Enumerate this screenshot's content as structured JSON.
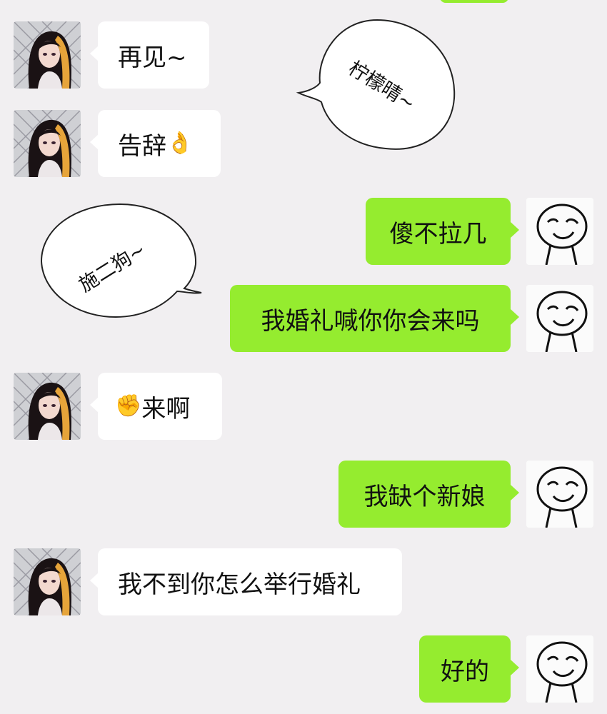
{
  "messages": [
    {
      "side": "left",
      "text": "再见~"
    },
    {
      "side": "left",
      "text": "告辞",
      "emoji": "👌"
    },
    {
      "side": "right",
      "text": "傻不拉几"
    },
    {
      "side": "right",
      "text": "我婚礼喊你你会来吗"
    },
    {
      "side": "left",
      "text": "来啊",
      "emoji": "✊"
    },
    {
      "side": "right",
      "text": "我缺个新娘"
    },
    {
      "side": "left",
      "text": "我不到你怎么举行婚礼"
    },
    {
      "side": "right",
      "text": "好的"
    }
  ],
  "speech_bubbles": [
    {
      "text": "柠檬晴~"
    },
    {
      "text": "施二狗~"
    }
  ],
  "icons": {
    "left_avatar": "anime-girl-avatar-icon",
    "right_avatar": "stickman-smile-avatar-icon"
  }
}
